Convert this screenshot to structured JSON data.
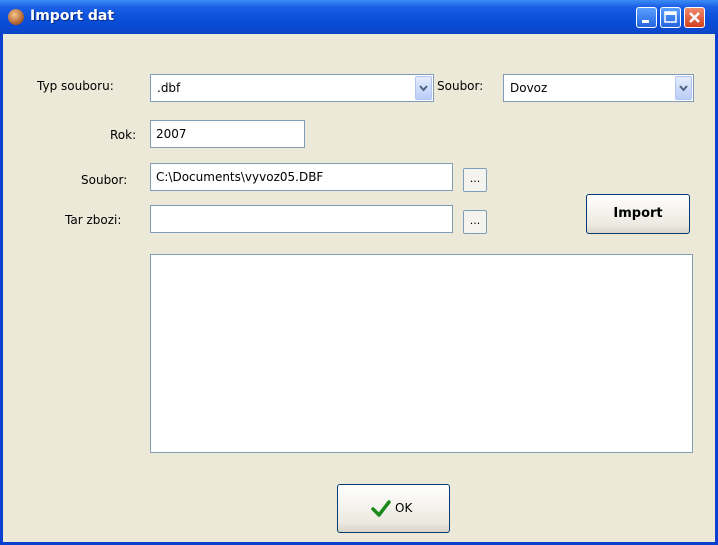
{
  "window": {
    "title": "Import dat"
  },
  "form": {
    "typ_label": "Typ souboru:",
    "typ_value": ".dbf",
    "soubor_select_label": "Soubor:",
    "soubor_select_value": "Dovoz",
    "rok_label": "Rok:",
    "rok_value": "2007",
    "soubor_path_label": "Soubor:",
    "soubor_path_value": "C:\\Documents\\vyvoz05.DBF",
    "tar_label": "Tar zbozi:",
    "tar_value": "",
    "browse_label": "...",
    "import_label": "Import",
    "log_text": ""
  },
  "footer": {
    "ok_label": "OK"
  },
  "icons": {
    "app": "app-icon",
    "minimize": "minimize-icon",
    "maximize": "maximize-icon",
    "close": "close-icon",
    "ok": "checkmark-icon",
    "dropdown": "chevron-down-icon"
  },
  "colors": {
    "titlebar": "#0a4ed8",
    "dialog_bg": "#ece9d8",
    "checkmark": "#1b8a1b",
    "close": "#d4401e"
  }
}
